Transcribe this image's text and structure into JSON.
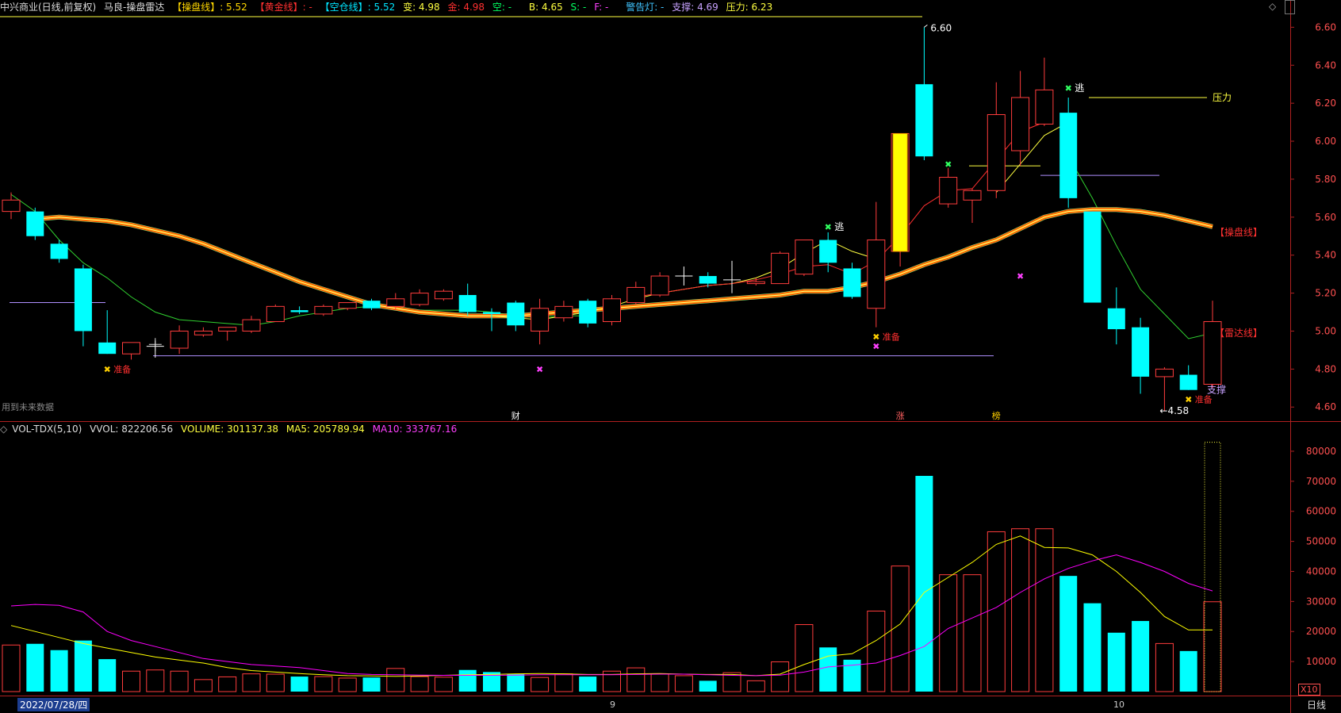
{
  "header": {
    "stock_title": "中兴商业(日线,前复权)",
    "indicator_name": "马良-操盘雷达",
    "pan_label": "【操盘线】",
    "pan_value": ": 5.52",
    "gold_label": "【黄金线】",
    "gold_value": ": -",
    "kong_label": "【空仓线】",
    "kong_value": ": 5.52",
    "bian": "变: 4.98",
    "jin": "金: 4.98",
    "kong2": "空: -",
    "b_val": "B: 4.65",
    "s_val": "S: -",
    "f_val": "F: -",
    "warn": "警告灯: -",
    "support": "支撑: 4.69",
    "pressure": "压力: 6.23"
  },
  "volume_header": {
    "name": "VOL-TDX(5,10)",
    "vvol": "VVOL: 822206.56",
    "volume": "VOLUME: 301137.38",
    "ma5": "MA5: 205789.94",
    "ma10": "MA10: 333767.16"
  },
  "footer": {
    "date": "2022/07/28/四",
    "period": "日线",
    "month_9": "9",
    "month_10": "10",
    "future_data": "用到未来数据",
    "x10": "X10"
  },
  "colors": {
    "up": "#ff3c3c",
    "down": "#00ffff",
    "ma_fast": "#ffff00",
    "ma_slow": "#ff00ff",
    "pan_line": "#ff8c00",
    "kong_line": "#7fff7f",
    "background": "#000000"
  },
  "chart_data": {
    "type": "candlestick",
    "price_axis": {
      "ticks": [
        4.6,
        4.8,
        5.0,
        5.2,
        5.4,
        5.6,
        5.8,
        6.0,
        6.2,
        6.4,
        6.6
      ],
      "range": [
        4.53,
        6.66
      ]
    },
    "volume_axis": {
      "ticks": [
        10000,
        20000,
        30000,
        40000,
        50000,
        60000,
        70000,
        80000
      ],
      "range": [
        0,
        85000
      ]
    },
    "candles": [
      {
        "o": 5.63,
        "h": 5.73,
        "l": 5.59,
        "c": 5.69
      },
      {
        "o": 5.63,
        "h": 5.65,
        "l": 5.48,
        "c": 5.5
      },
      {
        "o": 5.46,
        "h": 5.48,
        "l": 5.36,
        "c": 5.38
      },
      {
        "o": 5.33,
        "h": 5.35,
        "l": 4.92,
        "c": 5.0
      },
      {
        "o": 4.94,
        "h": 5.11,
        "l": 4.88,
        "c": 4.88
      },
      {
        "o": 4.88,
        "h": 4.94,
        "l": 4.85,
        "c": 4.94
      },
      {
        "o": 4.92,
        "h": 4.95,
        "l": 4.86,
        "c": 4.92
      },
      {
        "o": 4.91,
        "h": 5.03,
        "l": 4.88,
        "c": 5.0
      },
      {
        "o": 4.98,
        "h": 5.02,
        "l": 4.97,
        "c": 5.0
      },
      {
        "o": 5.0,
        "h": 5.02,
        "l": 4.95,
        "c": 5.02
      },
      {
        "o": 5.0,
        "h": 5.08,
        "l": 4.99,
        "c": 5.06
      },
      {
        "o": 5.05,
        "h": 5.14,
        "l": 5.05,
        "c": 5.13
      },
      {
        "o": 5.11,
        "h": 5.13,
        "l": 5.09,
        "c": 5.1
      },
      {
        "o": 5.09,
        "h": 5.14,
        "l": 5.08,
        "c": 5.13
      },
      {
        "o": 5.12,
        "h": 5.15,
        "l": 5.11,
        "c": 5.15
      },
      {
        "o": 5.16,
        "h": 5.17,
        "l": 5.11,
        "c": 5.12
      },
      {
        "o": 5.13,
        "h": 5.2,
        "l": 5.11,
        "c": 5.17
      },
      {
        "o": 5.14,
        "h": 5.22,
        "l": 5.13,
        "c": 5.2
      },
      {
        "o": 5.17,
        "h": 5.22,
        "l": 5.16,
        "c": 5.21
      },
      {
        "o": 5.19,
        "h": 5.25,
        "l": 5.08,
        "c": 5.1
      },
      {
        "o": 5.1,
        "h": 5.12,
        "l": 5.0,
        "c": 5.09
      },
      {
        "o": 5.15,
        "h": 5.16,
        "l": 5.0,
        "c": 5.03
      },
      {
        "o": 5.0,
        "h": 5.17,
        "l": 4.93,
        "c": 5.12
      },
      {
        "o": 5.07,
        "h": 5.16,
        "l": 5.05,
        "c": 5.13
      },
      {
        "o": 5.16,
        "h": 5.17,
        "l": 5.02,
        "c": 5.04
      },
      {
        "o": 5.05,
        "h": 5.19,
        "l": 5.03,
        "c": 5.17
      },
      {
        "o": 5.15,
        "h": 5.26,
        "l": 5.14,
        "c": 5.23
      },
      {
        "o": 5.19,
        "h": 5.31,
        "l": 5.18,
        "c": 5.29
      },
      {
        "o": 5.29,
        "h": 5.34,
        "l": 5.24,
        "c": 5.29
      },
      {
        "o": 5.29,
        "h": 5.31,
        "l": 5.23,
        "c": 5.25
      },
      {
        "o": 5.27,
        "h": 5.37,
        "l": 5.2,
        "c": 5.27
      },
      {
        "o": 5.25,
        "h": 5.28,
        "l": 5.24,
        "c": 5.26
      },
      {
        "o": 5.25,
        "h": 5.42,
        "l": 5.25,
        "c": 5.41
      },
      {
        "o": 5.3,
        "h": 5.48,
        "l": 5.29,
        "c": 5.48
      },
      {
        "o": 5.48,
        "h": 5.52,
        "l": 5.31,
        "c": 5.36
      },
      {
        "o": 5.33,
        "h": 5.36,
        "l": 5.17,
        "c": 5.18
      },
      {
        "o": 5.12,
        "h": 5.68,
        "l": 5.02,
        "c": 5.48
      },
      {
        "o": 5.42,
        "h": 6.04,
        "l": 5.34,
        "c": 6.04
      },
      {
        "o": 6.3,
        "h": 6.6,
        "l": 5.9,
        "c": 5.92
      },
      {
        "o": 5.67,
        "h": 5.86,
        "l": 5.65,
        "c": 5.81
      },
      {
        "o": 5.69,
        "h": 5.75,
        "l": 5.57,
        "c": 5.74
      },
      {
        "o": 5.74,
        "h": 6.31,
        "l": 5.7,
        "c": 6.14
      },
      {
        "o": 5.95,
        "h": 6.37,
        "l": 5.87,
        "c": 6.23
      },
      {
        "o": 6.09,
        "h": 6.44,
        "l": 6.08,
        "c": 6.27
      },
      {
        "o": 6.15,
        "h": 6.23,
        "l": 5.65,
        "c": 5.7
      },
      {
        "o": 5.63,
        "h": 5.63,
        "l": 5.15,
        "c": 5.15
      },
      {
        "o": 5.12,
        "h": 5.23,
        "l": 4.93,
        "c": 5.01
      },
      {
        "o": 5.02,
        "h": 5.07,
        "l": 4.67,
        "c": 4.76
      },
      {
        "o": 4.76,
        "h": 4.81,
        "l": 4.58,
        "c": 4.8
      },
      {
        "o": 4.77,
        "h": 4.82,
        "l": 4.69,
        "c": 4.69
      },
      {
        "o": 4.72,
        "h": 5.16,
        "l": 4.7,
        "c": 5.05
      }
    ],
    "volumes": [
      15500,
      15900,
      13800,
      17000,
      10800,
      6800,
      7200,
      6800,
      4000,
      4900,
      5900,
      5800,
      5000,
      5000,
      4500,
      4700,
      7700,
      5000,
      4800,
      7200,
      6500,
      5900,
      4700,
      5900,
      5000,
      6800,
      7900,
      5900,
      5300,
      3600,
      6300,
      3600,
      9900,
      22300,
      14700,
      10600,
      26800,
      41800,
      71800,
      38900,
      38900,
      53200,
      54200,
      54200,
      38500,
      29400,
      19600,
      23500,
      16000,
      13500,
      29900
    ],
    "ma5": [
      22000,
      20000,
      18000,
      16000,
      14500,
      13000,
      11500,
      10500,
      9500,
      8000,
      7000,
      6500,
      6000,
      5600,
      5300,
      5200,
      5100,
      5200,
      5400,
      5600,
      5700,
      5900,
      6000,
      5900,
      5700,
      5700,
      5900,
      6000,
      5800,
      5700,
      5700,
      5300,
      5800,
      9000,
      11800,
      12600,
      17000,
      22500,
      33000,
      38000,
      43000,
      49000,
      51800,
      48000,
      47800,
      45500,
      40000,
      33000,
      25000,
      20500,
      20500
    ],
    "ma10": [
      28500,
      29000,
      28700,
      26500,
      20000,
      17000,
      15000,
      13000,
      11000,
      10000,
      9000,
      8500,
      8000,
      7000,
      6000,
      5700,
      5600,
      5500,
      5400,
      5400,
      5400,
      5500,
      5600,
      5600,
      5600,
      5600,
      5700,
      5800,
      5800,
      5600,
      5400,
      5300,
      5500,
      6500,
      8200,
      8800,
      9500,
      12000,
      15000,
      21000,
      24500,
      28000,
      33000,
      37500,
      41000,
      43500,
      45500,
      43000,
      40000,
      36000,
      33500
    ],
    "pan_line": [
      null,
      5.59,
      5.6,
      5.59,
      5.58,
      5.56,
      5.53,
      5.5,
      5.46,
      5.41,
      5.36,
      5.31,
      5.26,
      5.22,
      5.18,
      5.14,
      5.12,
      5.1,
      5.09,
      5.08,
      5.08,
      5.08,
      5.09,
      5.1,
      5.11,
      5.12,
      5.13,
      5.14,
      5.15,
      5.16,
      5.17,
      5.18,
      5.19,
      5.21,
      5.21,
      5.23,
      5.26,
      5.3,
      5.35,
      5.39,
      5.44,
      5.48,
      5.54,
      5.6,
      5.63,
      5.64,
      5.64,
      5.63,
      5.61,
      5.58,
      5.55
    ],
    "yellow_line": [
      null,
      null,
      null,
      null,
      null,
      null,
      null,
      null,
      null,
      null,
      null,
      null,
      null,
      null,
      null,
      null,
      null,
      null,
      null,
      null,
      5.08,
      5.07,
      5.06,
      5.08,
      5.1,
      5.13,
      5.17,
      5.2,
      5.22,
      5.24,
      5.25,
      5.28,
      5.33,
      5.41,
      5.48,
      5.42,
      5.38,
      null,
      null,
      null,
      null,
      5.73,
      5.88,
      6.03,
      6.1,
      null,
      null,
      null,
      null,
      null,
      null
    ],
    "kong_line": [
      5.72,
      5.63,
      5.48,
      5.36,
      5.28,
      5.18,
      5.1,
      5.06,
      5.05,
      5.04,
      5.03,
      5.05,
      5.08,
      5.1,
      5.12,
      5.13,
      5.12,
      5.11,
      5.11,
      5.11,
      5.1,
      5.08,
      5.07,
      5.08,
      5.08,
      null,
      null,
      null,
      null,
      null,
      null,
      null,
      null,
      null,
      null,
      null,
      null,
      null,
      null,
      null,
      null,
      null,
      null,
      null,
      5.92,
      5.7,
      5.45,
      5.22,
      5.09,
      4.96,
      4.99
    ],
    "red_line": [
      null,
      null,
      null,
      null,
      null,
      null,
      null,
      null,
      null,
      null,
      null,
      null,
      null,
      null,
      null,
      null,
      null,
      null,
      null,
      null,
      null,
      null,
      null,
      null,
      null,
      null,
      5.18,
      5.2,
      5.22,
      5.24,
      5.25,
      5.27,
      5.3,
      5.34,
      5.35,
      5.3,
      5.37,
      5.5,
      5.66,
      5.74,
      5.75,
      5.9,
      6.05,
      6.1,
      null,
      null,
      null,
      null,
      null,
      null,
      null
    ],
    "annotations": {
      "high_label": "6.60",
      "low_label": "←4.58",
      "pressure_label": "压力",
      "support_label": "支撑",
      "pan_tag": "【操盘线】",
      "radar_tag": "【雷达线】",
      "escape": "逃",
      "prepare": "准备",
      "cai": "财",
      "zhang": "涨",
      "bang": "榜"
    }
  }
}
